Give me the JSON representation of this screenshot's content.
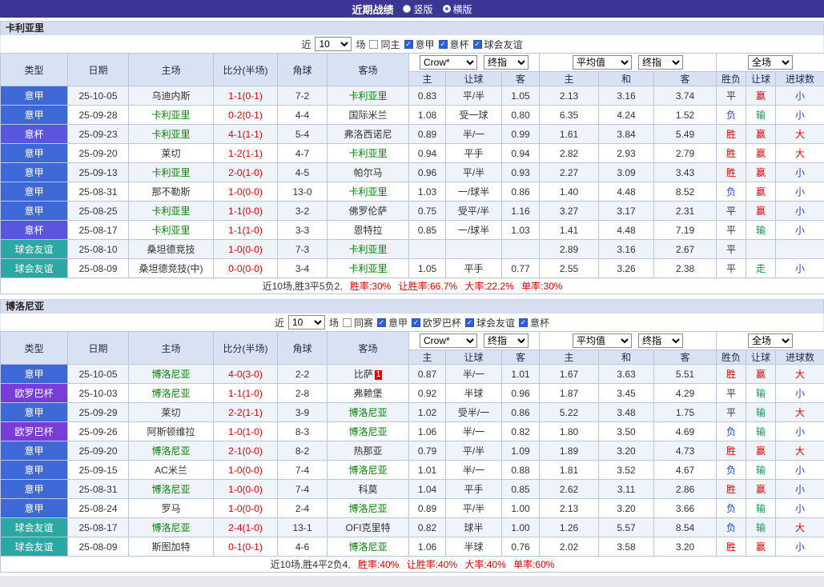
{
  "title_bar": {
    "title": "近期战绩",
    "vertical_label": "竖版",
    "horizontal_label": "横版"
  },
  "columns": {
    "type": "类型",
    "date": "日期",
    "home": "主场",
    "score": "比分(半场)",
    "corners": "角球",
    "away": "客场",
    "ah_home": "主",
    "ah_line": "让球",
    "ah_away": "客",
    "eu_home": "主",
    "eu_draw": "和",
    "eu_away": "客",
    "result": "胜负",
    "han_result": "让球",
    "goals": "进球数"
  },
  "colors": {
    "title_bar": "#3B3693",
    "header_bg": "#D9E2F2",
    "row_alt": "#EFF3FA",
    "border": "#BAC6DE",
    "subject": "#008000",
    "red": "#E10000",
    "blue": "#2144CC",
    "green": "#00A050",
    "lg_a": "#3E68D5",
    "lg_cup": "#5A55DE",
    "lg_uel": "#7B3BD6",
    "lg_fr": "#2BA8A3"
  },
  "sections": [
    {
      "team": "卡利亚里",
      "filter": {
        "near_label": "近",
        "count": "10",
        "games_label": "场",
        "same_label": "同主",
        "leagues": [
          "意甲",
          "意杯",
          "球会友谊"
        ]
      },
      "selectors": {
        "company": "Crow*",
        "company_stage": "终指",
        "average": "平均值",
        "average_stage": "终指",
        "scope": "全场"
      },
      "rows": [
        {
          "type": "意甲",
          "type_c": "lg-a",
          "date": "25-10-05",
          "home": "乌迪内斯",
          "home_c": "opp",
          "score": "1-1(0-1)",
          "corners": "7-2",
          "away": "卡利亚里",
          "away_c": "subject",
          "ah": [
            "0.83",
            "平/半",
            "1.05"
          ],
          "eu": [
            "2.13",
            "3.16",
            "3.74"
          ],
          "res": "平",
          "res_c": "c-dark",
          "han": "赢",
          "han_c": "c-red",
          "goal": "小",
          "goal_c": "c-blue"
        },
        {
          "type": "意甲",
          "type_c": "lg-a",
          "date": "25-09-28",
          "home": "卡利亚里",
          "home_c": "subject",
          "score": "0-2(0-1)",
          "corners": "4-4",
          "away": "国际米兰",
          "away_c": "opp",
          "ah": [
            "1.08",
            "受一球",
            "0.80"
          ],
          "eu": [
            "6.35",
            "4.24",
            "1.52"
          ],
          "res": "负",
          "res_c": "c-blue",
          "han": "输",
          "han_c": "c-green",
          "goal": "小",
          "goal_c": "c-blue"
        },
        {
          "type": "意杯",
          "type_c": "lg-cup",
          "date": "25-09-23",
          "home": "卡利亚里",
          "home_c": "subject",
          "score": "4-1(1-1)",
          "corners": "5-4",
          "away": "弗洛西诺尼",
          "away_c": "opp",
          "ah": [
            "0.89",
            "半/一",
            "0.99"
          ],
          "eu": [
            "1.61",
            "3.84",
            "5.49"
          ],
          "res": "胜",
          "res_c": "c-red",
          "han": "赢",
          "han_c": "c-red",
          "goal": "大",
          "goal_c": "c-red"
        },
        {
          "type": "意甲",
          "type_c": "lg-a",
          "date": "25-09-20",
          "home": "莱切",
          "home_c": "opp",
          "score": "1-2(1-1)",
          "corners": "4-7",
          "away": "卡利亚里",
          "away_c": "subject",
          "ah": [
            "0.94",
            "平手",
            "0.94"
          ],
          "eu": [
            "2.82",
            "2.93",
            "2.79"
          ],
          "res": "胜",
          "res_c": "c-red",
          "han": "赢",
          "han_c": "c-red",
          "goal": "大",
          "goal_c": "c-red"
        },
        {
          "type": "意甲",
          "type_c": "lg-a",
          "date": "25-09-13",
          "home": "卡利亚里",
          "home_c": "subject",
          "score": "2-0(1-0)",
          "corners": "4-5",
          "away": "帕尔马",
          "away_c": "opp",
          "ah": [
            "0.96",
            "平/半",
            "0.93"
          ],
          "eu": [
            "2.27",
            "3.09",
            "3.43"
          ],
          "res": "胜",
          "res_c": "c-red",
          "han": "赢",
          "han_c": "c-red",
          "goal": "小",
          "goal_c": "c-blue"
        },
        {
          "type": "意甲",
          "type_c": "lg-a",
          "date": "25-08-31",
          "home": "那不勒斯",
          "home_c": "opp",
          "score": "1-0(0-0)",
          "corners": "13-0",
          "away": "卡利亚里",
          "away_c": "subject",
          "ah": [
            "1.03",
            "一/球半",
            "0.86"
          ],
          "eu": [
            "1.40",
            "4.48",
            "8.52"
          ],
          "res": "负",
          "res_c": "c-blue",
          "han": "赢",
          "han_c": "c-red",
          "goal": "小",
          "goal_c": "c-blue"
        },
        {
          "type": "意甲",
          "type_c": "lg-a",
          "date": "25-08-25",
          "home": "卡利亚里",
          "home_c": "subject",
          "score": "1-1(0-0)",
          "corners": "3-2",
          "away": "佛罗伦萨",
          "away_c": "opp",
          "ah": [
            "0.75",
            "受平/半",
            "1.16"
          ],
          "eu": [
            "3.27",
            "3.17",
            "2.31"
          ],
          "res": "平",
          "res_c": "c-dark",
          "han": "赢",
          "han_c": "c-red",
          "goal": "小",
          "goal_c": "c-blue"
        },
        {
          "type": "意杯",
          "type_c": "lg-cup",
          "date": "25-08-17",
          "home": "卡利亚里",
          "home_c": "subject",
          "score": "1-1(1-0)",
          "corners": "3-3",
          "away": "恩特拉",
          "away_c": "opp",
          "ah": [
            "0.85",
            "一/球半",
            "1.03"
          ],
          "eu": [
            "1.41",
            "4.48",
            "7.19"
          ],
          "res": "平",
          "res_c": "c-dark",
          "han": "输",
          "han_c": "c-green",
          "goal": "小",
          "goal_c": "c-blue"
        },
        {
          "type": "球会友谊",
          "type_c": "lg-fr",
          "date": "25-08-10",
          "home": "桑坦德竞技",
          "home_c": "opp",
          "score": "1-0(0-0)",
          "corners": "7-3",
          "away": "卡利亚里",
          "away_c": "subject",
          "ah": [
            "",
            "",
            ""
          ],
          "eu": [
            "2.89",
            "3.16",
            "2.67"
          ],
          "res": "平",
          "res_c": "c-dark",
          "han": "",
          "han_c": "",
          "goal": "",
          "goal_c": ""
        },
        {
          "type": "球会友谊",
          "type_c": "lg-fr",
          "date": "25-08-09",
          "home": "桑坦德竞技(中)",
          "home_c": "opp",
          "score": "0-0(0-0)",
          "corners": "3-4",
          "away": "卡利亚里",
          "away_c": "subject",
          "ah": [
            "1.05",
            "平手",
            "0.77"
          ],
          "eu": [
            "2.55",
            "3.26",
            "2.38"
          ],
          "res": "平",
          "res_c": "c-dark",
          "han": "走",
          "han_c": "c-green",
          "goal": "小",
          "goal_c": "c-blue"
        }
      ],
      "summary": {
        "prefix": "近10场,胜3平5负2,",
        "rates": [
          "胜率:30%",
          "让胜率:66.7%",
          "大率:22.2%",
          "单率:30%"
        ]
      }
    },
    {
      "team": "博洛尼亚",
      "filter": {
        "near_label": "近",
        "count": "10",
        "games_label": "场",
        "same_label": "同赛",
        "leagues": [
          "意甲",
          "欧罗巴杯",
          "球会友谊",
          "意杯"
        ]
      },
      "selectors": {
        "company": "Crow*",
        "company_stage": "终指",
        "average": "平均值",
        "average_stage": "终指",
        "scope": "全场"
      },
      "rows": [
        {
          "type": "意甲",
          "type_c": "lg-a",
          "date": "25-10-05",
          "home": "博洛尼亚",
          "home_c": "subject",
          "score": "4-0(3-0)",
          "corners": "2-2",
          "away": "比萨",
          "away_c": "opp",
          "away_card": "1",
          "ah": [
            "0.87",
            "半/一",
            "1.01"
          ],
          "eu": [
            "1.67",
            "3.63",
            "5.51"
          ],
          "res": "胜",
          "res_c": "c-red",
          "han": "赢",
          "han_c": "c-red",
          "goal": "大",
          "goal_c": "c-red"
        },
        {
          "type": "欧罗巴杯",
          "type_c": "lg-uel",
          "date": "25-10-03",
          "home": "博洛尼亚",
          "home_c": "subject",
          "score": "1-1(1-0)",
          "corners": "2-8",
          "away": "弗赖堡",
          "away_c": "opp",
          "ah": [
            "0.92",
            "半球",
            "0.96"
          ],
          "eu": [
            "1.87",
            "3.45",
            "4.29"
          ],
          "res": "平",
          "res_c": "c-dark",
          "han": "输",
          "han_c": "c-green",
          "goal": "小",
          "goal_c": "c-blue"
        },
        {
          "type": "意甲",
          "type_c": "lg-a",
          "date": "25-09-29",
          "home": "莱切",
          "home_c": "opp",
          "score": "2-2(1-1)",
          "corners": "3-9",
          "away": "博洛尼亚",
          "away_c": "subject",
          "ah": [
            "1.02",
            "受半/一",
            "0.86"
          ],
          "eu": [
            "5.22",
            "3.48",
            "1.75"
          ],
          "res": "平",
          "res_c": "c-dark",
          "han": "输",
          "han_c": "c-green",
          "goal": "大",
          "goal_c": "c-red"
        },
        {
          "type": "欧罗巴杯",
          "type_c": "lg-uel",
          "date": "25-09-26",
          "home": "阿斯顿维拉",
          "home_c": "opp",
          "score": "1-0(1-0)",
          "corners": "8-3",
          "away": "博洛尼亚",
          "away_c": "subject",
          "ah": [
            "1.06",
            "半/一",
            "0.82"
          ],
          "eu": [
            "1.80",
            "3.50",
            "4.69"
          ],
          "res": "负",
          "res_c": "c-blue",
          "han": "输",
          "han_c": "c-green",
          "goal": "小",
          "goal_c": "c-blue"
        },
        {
          "type": "意甲",
          "type_c": "lg-a",
          "date": "25-09-20",
          "home": "博洛尼亚",
          "home_c": "subject",
          "score": "2-1(0-0)",
          "corners": "8-2",
          "away": "热那亚",
          "away_c": "opp",
          "ah": [
            "0.79",
            "平/半",
            "1.09"
          ],
          "eu": [
            "1.89",
            "3.20",
            "4.73"
          ],
          "res": "胜",
          "res_c": "c-red",
          "han": "赢",
          "han_c": "c-red",
          "goal": "大",
          "goal_c": "c-red"
        },
        {
          "type": "意甲",
          "type_c": "lg-a",
          "date": "25-09-15",
          "home": "AC米兰",
          "home_c": "opp",
          "score": "1-0(0-0)",
          "corners": "7-4",
          "away": "博洛尼亚",
          "away_c": "subject",
          "ah": [
            "1.01",
            "半/一",
            "0.88"
          ],
          "eu": [
            "1.81",
            "3.52",
            "4.67"
          ],
          "res": "负",
          "res_c": "c-blue",
          "han": "输",
          "han_c": "c-green",
          "goal": "小",
          "goal_c": "c-blue"
        },
        {
          "type": "意甲",
          "type_c": "lg-a",
          "date": "25-08-31",
          "home": "博洛尼亚",
          "home_c": "subject",
          "score": "1-0(0-0)",
          "corners": "7-4",
          "away": "科莫",
          "away_c": "opp",
          "ah": [
            "1.04",
            "平手",
            "0.85"
          ],
          "eu": [
            "2.62",
            "3.11",
            "2.86"
          ],
          "res": "胜",
          "res_c": "c-red",
          "han": "赢",
          "han_c": "c-red",
          "goal": "小",
          "goal_c": "c-blue"
        },
        {
          "type": "意甲",
          "type_c": "lg-a",
          "date": "25-08-24",
          "home": "罗马",
          "home_c": "opp",
          "score": "1-0(0-0)",
          "corners": "2-4",
          "away": "博洛尼亚",
          "away_c": "subject",
          "ah": [
            "0.89",
            "平/半",
            "1.00"
          ],
          "eu": [
            "2.13",
            "3.20",
            "3.66"
          ],
          "res": "负",
          "res_c": "c-blue",
          "han": "输",
          "han_c": "c-green",
          "goal": "小",
          "goal_c": "c-blue"
        },
        {
          "type": "球会友谊",
          "type_c": "lg-fr",
          "date": "25-08-17",
          "home": "博洛尼亚",
          "home_c": "subject",
          "score": "2-4(1-0)",
          "corners": "13-1",
          "away": "OFI克里特",
          "away_c": "opp",
          "ah": [
            "0.82",
            "球半",
            "1.00"
          ],
          "eu": [
            "1.26",
            "5.57",
            "8.54"
          ],
          "res": "负",
          "res_c": "c-blue",
          "han": "输",
          "han_c": "c-green",
          "goal": "大",
          "goal_c": "c-red"
        },
        {
          "type": "球会友谊",
          "type_c": "lg-fr",
          "date": "25-08-09",
          "home": "斯图加特",
          "home_c": "opp",
          "score": "0-1(0-1)",
          "corners": "4-6",
          "away": "博洛尼亚",
          "away_c": "subject",
          "ah": [
            "1.06",
            "半球",
            "0.76"
          ],
          "eu": [
            "2.02",
            "3.58",
            "3.20"
          ],
          "res": "胜",
          "res_c": "c-red",
          "han": "赢",
          "han_c": "c-red",
          "goal": "小",
          "goal_c": "c-blue"
        }
      ],
      "summary": {
        "prefix": "近10场,胜4平2负4,",
        "rates": [
          "胜率:40%",
          "让胜率:40%",
          "大率:40%",
          "单率:60%"
        ]
      }
    }
  ]
}
